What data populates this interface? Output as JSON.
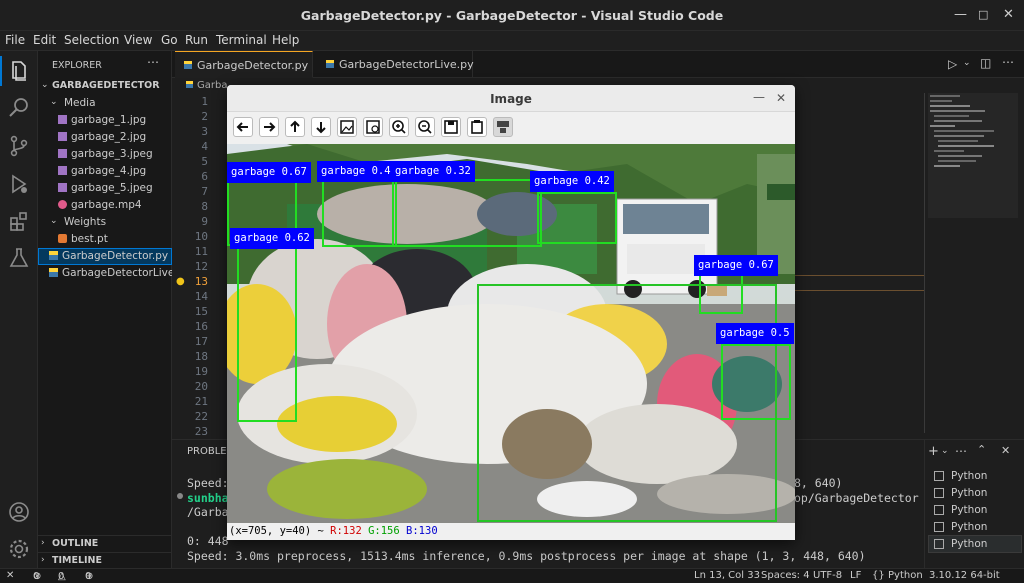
{
  "window": {
    "title": "GarbageDetector.py - GarbageDetector - Visual Studio Code"
  },
  "menu": [
    "File",
    "Edit",
    "Selection",
    "View",
    "Go",
    "Run",
    "Terminal",
    "Help"
  ],
  "explorer": {
    "title": "EXPLORER",
    "root": "GARBAGEDETECTOR",
    "items": [
      {
        "label": "Media",
        "type": "folder"
      },
      {
        "label": "garbage_1.jpg",
        "type": "image"
      },
      {
        "label": "garbage_2.jpg",
        "type": "image"
      },
      {
        "label": "garbage_3.jpeg",
        "type": "image"
      },
      {
        "label": "garbage_4.jpg",
        "type": "image"
      },
      {
        "label": "garbage_5.jpeg",
        "type": "image"
      },
      {
        "label": "garbage.mp4",
        "type": "video"
      },
      {
        "label": "Weights",
        "type": "folder"
      },
      {
        "label": "best.pt",
        "type": "rss"
      },
      {
        "label": "GarbageDetector.py",
        "type": "python"
      },
      {
        "label": "GarbageDetectorLive...",
        "type": "python"
      }
    ],
    "outline": "OUTLINE",
    "timeline": "TIMELINE"
  },
  "tabs": [
    {
      "label": "GarbageDetector.py",
      "active": true
    },
    {
      "label": "GarbageDetectorLive.py",
      "active": false
    }
  ],
  "breadcrumb": "Garba",
  "line_numbers": [
    "1",
    "2",
    "3",
    "4",
    "5",
    "6",
    "7",
    "8",
    "9",
    "10",
    "11",
    "12",
    "13",
    "14",
    "15",
    "16",
    "17",
    "18",
    "19",
    "20",
    "21",
    "22",
    "23"
  ],
  "current_line": "13",
  "panel": {
    "tab": "PROBLE",
    "lines": [
      "Speed:",
      "sunbha",
      "/Garba",
      "",
      "0: 448",
      "Speed: 3.0ms preprocess, 1513.4ms inference, 0.9ms postprocess per image at shape (1, 3, 448, 640)"
    ],
    "right_lines": [
      "8, 640)",
      "op/GarbageDetector"
    ]
  },
  "terminals": [
    "Python",
    "Python",
    "Python",
    "Python",
    "Python"
  ],
  "statusbar": {
    "errors": "0",
    "warnings": "0",
    "ports": "0",
    "position": "Ln 13, Col 33",
    "spaces": "Spaces: 4",
    "encoding": "UTF-8",
    "eol": "LF",
    "braces": "{}",
    "language": "Python",
    "interpreter": "3.10.12 64-bit"
  },
  "image_window": {
    "title": "Image",
    "status_coords": "(x=705, y=40) ~",
    "status_r": "R:132",
    "status_g": "G:156",
    "status_b": "B:130",
    "detections": [
      {
        "label": "garbage 0.67"
      },
      {
        "label": "garbage 0.4"
      },
      {
        "label": "garbage 0.32"
      },
      {
        "label": "garbage 0.42"
      },
      {
        "label": "garbage 0.62"
      },
      {
        "label": "garbage 0.67"
      },
      {
        "label": "garbage 0.5"
      }
    ],
    "tools": [
      "back-arrow",
      "forward-arrow",
      "up-arrow",
      "down-arrow",
      "image",
      "image-settings",
      "zoom-in",
      "zoom-out",
      "save",
      "copy",
      "properties"
    ]
  },
  "colors": {
    "accent_tab": "#f5a623",
    "selection": "#04395e",
    "detection_box": "#22dd22",
    "detection_label": "#0000ff"
  }
}
